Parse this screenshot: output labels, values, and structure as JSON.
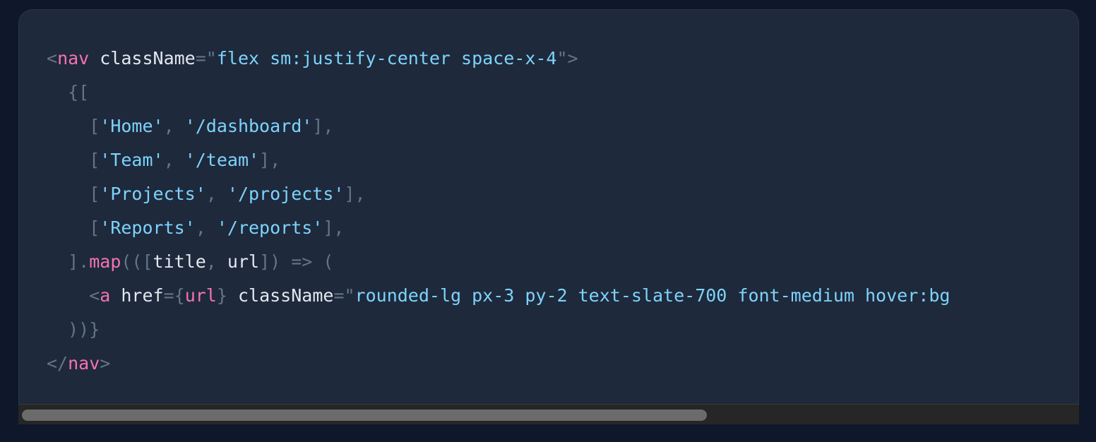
{
  "code_block": {
    "lines": [
      [
        {
          "t": "<",
          "c": "punct"
        },
        {
          "t": "nav",
          "c": "tag"
        },
        {
          "t": " className",
          "c": "attr"
        },
        {
          "t": "=\"",
          "c": "punct"
        },
        {
          "t": "flex sm:justify-center space-x-4",
          "c": "str"
        },
        {
          "t": "\">",
          "c": "punct"
        }
      ],
      [
        {
          "t": "  {[",
          "c": "punct"
        }
      ],
      [
        {
          "t": "    [",
          "c": "punct"
        },
        {
          "t": "'Home'",
          "c": "str"
        },
        {
          "t": ", ",
          "c": "punct"
        },
        {
          "t": "'/dashboard'",
          "c": "str"
        },
        {
          "t": "],",
          "c": "punct"
        }
      ],
      [
        {
          "t": "    [",
          "c": "punct"
        },
        {
          "t": "'Team'",
          "c": "str"
        },
        {
          "t": ", ",
          "c": "punct"
        },
        {
          "t": "'/team'",
          "c": "str"
        },
        {
          "t": "],",
          "c": "punct"
        }
      ],
      [
        {
          "t": "    [",
          "c": "punct"
        },
        {
          "t": "'Projects'",
          "c": "str"
        },
        {
          "t": ", ",
          "c": "punct"
        },
        {
          "t": "'/projects'",
          "c": "str"
        },
        {
          "t": "],",
          "c": "punct"
        }
      ],
      [
        {
          "t": "    [",
          "c": "punct"
        },
        {
          "t": "'Reports'",
          "c": "str"
        },
        {
          "t": ", ",
          "c": "punct"
        },
        {
          "t": "'/reports'",
          "c": "str"
        },
        {
          "t": "],",
          "c": "punct"
        }
      ],
      [
        {
          "t": "  ].",
          "c": "punct"
        },
        {
          "t": "map",
          "c": "kw"
        },
        {
          "t": "(([",
          "c": "punct"
        },
        {
          "t": "title",
          "c": "plain"
        },
        {
          "t": ", ",
          "c": "punct"
        },
        {
          "t": "url",
          "c": "plain"
        },
        {
          "t": "]) => (",
          "c": "punct"
        }
      ],
      [
        {
          "t": "    <",
          "c": "punct"
        },
        {
          "t": "a",
          "c": "tag"
        },
        {
          "t": " href",
          "c": "attr"
        },
        {
          "t": "={",
          "c": "punct"
        },
        {
          "t": "url",
          "c": "kw"
        },
        {
          "t": "}",
          "c": "punct"
        },
        {
          "t": " className",
          "c": "attr"
        },
        {
          "t": "=\"",
          "c": "punct"
        },
        {
          "t": "rounded-lg px-3 py-2 text-slate-700 font-medium hover:bg",
          "c": "str"
        }
      ],
      [
        {
          "t": "  ))}",
          "c": "punct"
        }
      ],
      [
        {
          "t": "</",
          "c": "punct"
        },
        {
          "t": "nav",
          "c": "tag"
        },
        {
          "t": ">",
          "c": "punct"
        }
      ]
    ]
  },
  "colors": {
    "page_background": "#0f172a",
    "card_background": "#1e293b",
    "tag": "#f472b6",
    "string": "#7dd3fc",
    "punctuation": "#64748b",
    "plain": "#e2e8f0",
    "scrollbar_track": "#262626",
    "scrollbar_thumb": "#6b6b6b"
  },
  "scrollbar": {
    "horizontal_visible_fraction": 0.65,
    "horizontal_position_fraction": 0.0
  }
}
